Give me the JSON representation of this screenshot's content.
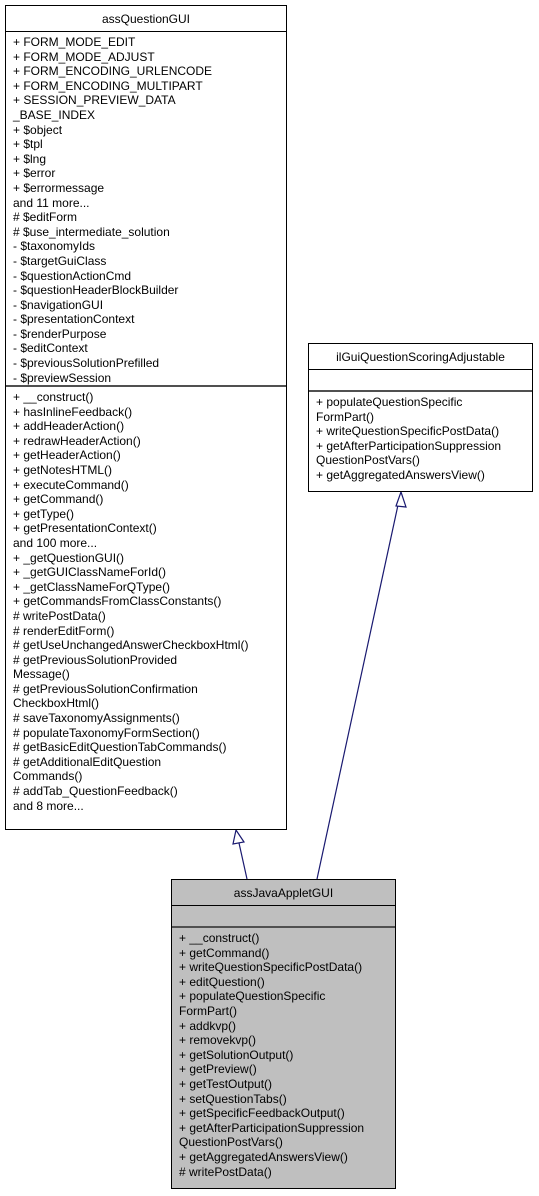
{
  "classes": {
    "base": {
      "name": "assQuestionGUI",
      "attributes": [
        "+ FORM_MODE_EDIT",
        "+ FORM_MODE_ADJUST",
        "+ FORM_ENCODING_URLENCODE",
        "+ FORM_ENCODING_MULTIPART",
        "+ SESSION_PREVIEW_DATA",
        "_BASE_INDEX",
        "+ $object",
        "+ $tpl",
        "+ $lng",
        "+ $error",
        "+ $errormessage",
        "and 11 more...",
        "# $editForm",
        "# $use_intermediate_solution",
        "- $taxonomyIds",
        "- $targetGuiClass",
        "- $questionActionCmd",
        "- $questionHeaderBlockBuilder",
        "- $navigationGUI",
        "- $presentationContext",
        "- $renderPurpose",
        "- $editContext",
        "- $previousSolutionPrefilled",
        "- $previewSession"
      ],
      "methods": [
        "+ __construct()",
        "+ hasInlineFeedback()",
        "+ addHeaderAction()",
        "+ redrawHeaderAction()",
        "+ getHeaderAction()",
        "+ getNotesHTML()",
        "+ executeCommand()",
        "+ getCommand()",
        "+ getType()",
        "+ getPresentationContext()",
        "and 100 more...",
        "+ _getQuestionGUI()",
        "+ _getGUIClassNameForId()",
        "+ _getClassNameForQType()",
        "+ getCommandsFromClassConstants()",
        "# writePostData()",
        "# renderEditForm()",
        "# getUseUnchangedAnswerCheckboxHtml()",
        "# getPreviousSolutionProvided",
        "Message()",
        "# getPreviousSolutionConfirmation",
        "CheckboxHtml()",
        "# saveTaxonomyAssignments()",
        "# populateTaxonomyFormSection()",
        "# getBasicEditQuestionTabCommands()",
        "# getAdditionalEditQuestion",
        "Commands()",
        "# addTab_QuestionFeedback()",
        "and 8 more..."
      ]
    },
    "interface": {
      "name": "ilGuiQuestionScoringAdjustable",
      "attributes": [],
      "methods": [
        "+ populateQuestionSpecific",
        "FormPart()",
        "+ writeQuestionSpecificPostData()",
        "+ getAfterParticipationSuppression",
        "QuestionPostVars()",
        "+ getAggregatedAnswersView()"
      ]
    },
    "derived": {
      "name": "assJavaAppletGUI",
      "attributes": [],
      "methods": [
        "+ __construct()",
        "+ getCommand()",
        "+ writeQuestionSpecificPostData()",
        "+ editQuestion()",
        "+ populateQuestionSpecific",
        "FormPart()",
        "+ addkvp()",
        "+ removekvp()",
        "+ getSolutionOutput()",
        "+ getPreview()",
        "+ getTestOutput()",
        "+ setQuestionTabs()",
        "+ getSpecificFeedbackOutput()",
        "+ getAfterParticipationSuppression",
        "QuestionPostVars()",
        "+ getAggregatedAnswersView()",
        "# writePostData()"
      ]
    }
  },
  "relations": [
    {
      "from": "assJavaAppletGUI",
      "to": "assQuestionGUI",
      "type": "inheritance"
    },
    {
      "from": "assJavaAppletGUI",
      "to": "ilGuiQuestionScoringAdjustable",
      "type": "inheritance"
    }
  ],
  "colors": {
    "edge": "#191970",
    "derived_fill": "#bfbfbf",
    "divider": "#505050"
  }
}
